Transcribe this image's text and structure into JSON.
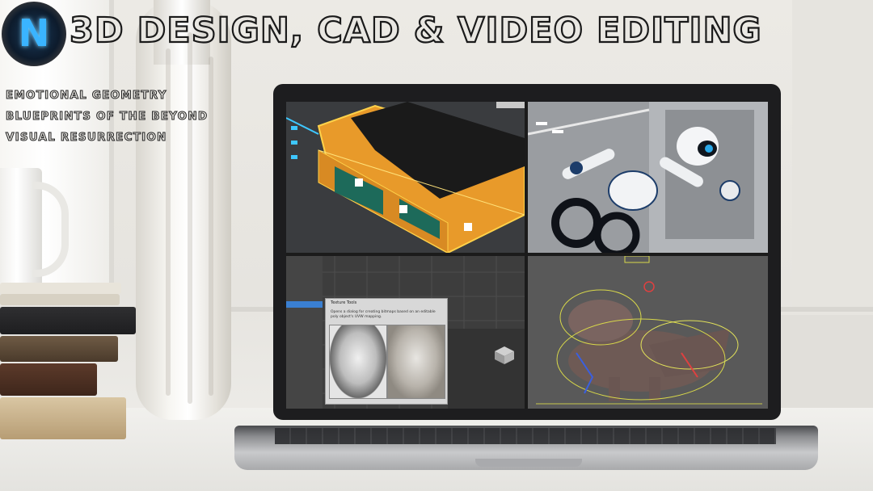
{
  "header": {
    "logo_letter": "N",
    "title": "3D DESIGN, CAD & VIDEO EDITING"
  },
  "taglines": [
    "EMOTIONAL GEOMETRY",
    "BLUEPRINTS OF THE BEYOND",
    "VISUAL RESURRECTION"
  ],
  "screen": {
    "texture_tools_title": "Texture Tools",
    "texture_tools_desc": "Opens a dialog for creating bitmaps based on an editable poly object's UVW mapping."
  },
  "colors": {
    "title_fill": "#e9e7e2",
    "title_outline": "#1a1a1a",
    "logo_accent": "#3ab4ff",
    "logo_ring": "#e8742a"
  }
}
